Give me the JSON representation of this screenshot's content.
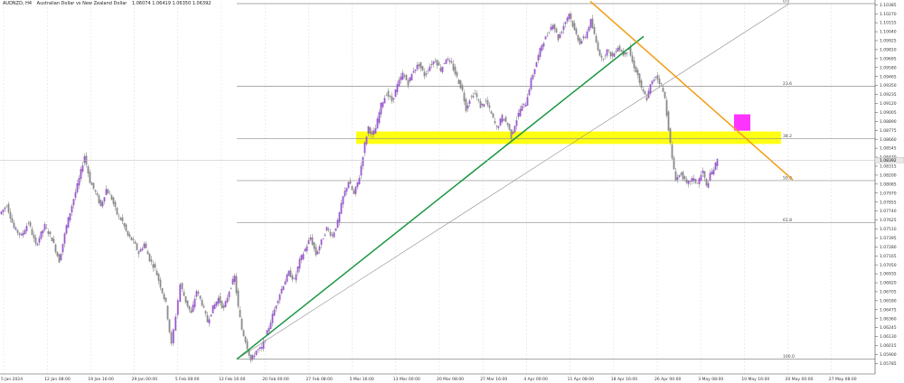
{
  "header": {
    "symbol": "AUDNZD, H4",
    "description": "Australian Dollar vs New Zealand Dollar",
    "ohlc": "1.06074 1.06419 1.06350 1.06392"
  },
  "colors": {
    "background": "#ffffff",
    "grid": "#d9d9d9",
    "bull": "#9b59d0",
    "bear": "#8a8a8a",
    "wick": "#777777",
    "fib": "#8c8c8c",
    "support_trend": "#1a9641",
    "resistance_trend": "#f39c12",
    "zone": "#ffff00",
    "marker": "#ff33ff",
    "thin_trend": "#888888"
  },
  "chart_data": {
    "type": "candlestick",
    "title": "",
    "xlabel": "",
    "ylabel": "",
    "ylim": [
      1.0565,
      1.104
    ],
    "y_ticks": [
      "1.10385",
      "1.10270",
      "1.10155",
      "1.10040",
      "1.09925",
      "1.09810",
      "1.09695",
      "1.09580",
      "1.09465",
      "1.09350",
      "1.09235",
      "1.09120",
      "1.09005",
      "1.08890",
      "1.08775",
      "1.08660",
      "1.08545",
      "1.08430",
      "1.08315",
      "1.08200",
      "1.08085",
      "1.07970",
      "1.07855",
      "1.07740",
      "1.07625",
      "1.07510",
      "1.07395",
      "1.07280",
      "1.07165",
      "1.07050",
      "1.06935",
      "1.06820",
      "1.06705",
      "1.06590",
      "1.06475",
      "1.06360",
      "1.06245",
      "1.06130",
      "1.06015",
      "1.05900",
      "1.05785"
    ],
    "current_price": "1.08392",
    "x_ticks": [
      "5 Jan 2024",
      "12 Jan 08:00",
      "19 Jan 16:00",
      "29 Jan 00:00",
      "5 Feb 08:00",
      "12 Feb 16:00",
      "20 Feb 00:00",
      "27 Feb 08:00",
      "5 Mar 16:00",
      "13 Mar 00:00",
      "20 Mar 08:00",
      "27 Mar 16:00",
      "4 Apr 00:00",
      "11 Apr 08:00",
      "18 Apr 16:00",
      "26 Apr 00:00",
      "3 May 08:00",
      "10 May 16:00",
      "20 May 00:00",
      "27 May 08:00"
    ],
    "close_path": [
      [
        0,
        1.077
      ],
      [
        8,
        1.0782
      ],
      [
        16,
        1.0752
      ],
      [
        24,
        1.0742
      ],
      [
        32,
        1.076
      ],
      [
        40,
        1.073
      ],
      [
        50,
        1.0755
      ],
      [
        58,
        1.0738
      ],
      [
        66,
        1.071
      ],
      [
        74,
        1.0755
      ],
      [
        82,
        1.079
      ],
      [
        88,
        1.0815
      ],
      [
        94,
        1.0845
      ],
      [
        100,
        1.0812
      ],
      [
        106,
        1.0798
      ],
      [
        112,
        1.078
      ],
      [
        118,
        1.0802
      ],
      [
        124,
        1.079
      ],
      [
        130,
        1.077
      ],
      [
        136,
        1.076
      ],
      [
        142,
        1.0742
      ],
      [
        148,
        1.0735
      ],
      [
        154,
        1.072
      ],
      [
        160,
        1.0732
      ],
      [
        166,
        1.0712
      ],
      [
        172,
        1.07
      ],
      [
        178,
        1.0678
      ],
      [
        184,
        1.0655
      ],
      [
        190,
        1.0602
      ],
      [
        195,
        1.064
      ],
      [
        200,
        1.068
      ],
      [
        206,
        1.0658
      ],
      [
        212,
        1.0642
      ],
      [
        218,
        1.0672
      ],
      [
        224,
        1.0655
      ],
      [
        230,
        1.0632
      ],
      [
        236,
        1.065
      ],
      [
        242,
        1.0662
      ],
      [
        248,
        1.0648
      ],
      [
        254,
        1.0672
      ],
      [
        260,
        1.069
      ],
      [
        264,
        1.065
      ],
      [
        268,
        1.0622
      ],
      [
        272,
        1.0608
      ],
      [
        278,
        1.0582
      ],
      [
        284,
        1.0595
      ],
      [
        290,
        1.0598
      ],
      [
        296,
        1.0618
      ],
      [
        302,
        1.064
      ],
      [
        308,
        1.0662
      ],
      [
        314,
        1.068
      ],
      [
        320,
        1.0695
      ],
      [
        326,
        1.0685
      ],
      [
        332,
        1.071
      ],
      [
        338,
        1.0725
      ],
      [
        344,
        1.074
      ],
      [
        350,
        1.0718
      ],
      [
        356,
        1.0735
      ],
      [
        362,
        1.0752
      ],
      [
        368,
        1.0742
      ],
      [
        374,
        1.076
      ],
      [
        380,
        1.0792
      ],
      [
        386,
        1.0812
      ],
      [
        392,
        1.0795
      ],
      [
        398,
        1.0818
      ],
      [
        404,
        1.086
      ],
      [
        408,
        1.0882
      ],
      [
        412,
        1.087
      ],
      [
        416,
        1.088
      ],
      [
        422,
        1.091
      ],
      [
        428,
        1.0925
      ],
      [
        434,
        1.0915
      ],
      [
        440,
        1.0935
      ],
      [
        446,
        1.095
      ],
      [
        452,
        1.0938
      ],
      [
        458,
        1.0955
      ],
      [
        464,
        1.0962
      ],
      [
        470,
        1.0948
      ],
      [
        476,
        1.096
      ],
      [
        482,
        1.0968
      ],
      [
        488,
        1.0955
      ],
      [
        494,
        1.097
      ],
      [
        500,
        1.0962
      ],
      [
        506,
        1.0945
      ],
      [
        512,
        1.0928
      ],
      [
        516,
        1.0905
      ],
      [
        520,
        1.0918
      ],
      [
        526,
        1.0925
      ],
      [
        532,
        1.0908
      ],
      [
        538,
        1.0915
      ],
      [
        544,
        1.0898
      ],
      [
        550,
        1.088
      ],
      [
        556,
        1.0895
      ],
      [
        562,
        1.0885
      ],
      [
        566,
        1.087
      ],
      [
        570,
        1.0885
      ],
      [
        576,
        1.0905
      ],
      [
        582,
        1.0912
      ],
      [
        588,
        1.0942
      ],
      [
        594,
        1.0965
      ],
      [
        600,
        1.0988
      ],
      [
        606,
        1.1
      ],
      [
        612,
        1.1015
      ],
      [
        618,
        1.0995
      ],
      [
        624,
        1.1012
      ],
      [
        630,
        1.1028
      ],
      [
        636,
        1.1005
      ],
      [
        642,
        1.099
      ],
      [
        648,
        1.0998
      ],
      [
        654,
        1.1018
      ],
      [
        660,
        1.099
      ],
      [
        666,
        1.0968
      ],
      [
        672,
        1.098
      ],
      [
        678,
        1.0972
      ],
      [
        684,
        1.0985
      ],
      [
        690,
        1.0975
      ],
      [
        696,
        1.0982
      ],
      [
        700,
        1.0965
      ],
      [
        706,
        1.0948
      ],
      [
        710,
        1.093
      ],
      [
        716,
        1.0918
      ],
      [
        720,
        1.0935
      ],
      [
        726,
        1.0948
      ],
      [
        732,
        1.0935
      ],
      [
        736,
        1.0918
      ],
      [
        740,
        1.088
      ],
      [
        744,
        1.084
      ],
      [
        748,
        1.0815
      ],
      [
        754,
        1.0822
      ],
      [
        760,
        1.0808
      ],
      [
        766,
        1.0815
      ],
      [
        772,
        1.081
      ],
      [
        778,
        1.0825
      ],
      [
        782,
        1.0805
      ],
      [
        786,
        1.082
      ],
      [
        790,
        1.0828
      ],
      [
        794,
        1.0839
      ]
    ],
    "fibonacci_levels": [
      {
        "label": "0.0",
        "value": 1.104
      },
      {
        "label": "23.6",
        "value": 1.0934
      },
      {
        "label": "38.2",
        "value": 1.0867
      },
      {
        "label": "50.0",
        "value": 1.0813
      },
      {
        "label": "61.8",
        "value": 1.0759
      },
      {
        "label": "100.0",
        "value": 1.0584
      }
    ],
    "yellow_zone": {
      "from": 1.086,
      "to": 1.0876
    },
    "support_trendline": [
      [
        1.0584
      ],
      [
        1.0998
      ]
    ],
    "resistance_trendline": [
      [
        1.1043
      ],
      [
        1.0814
      ]
    ],
    "thin_trendline": [
      [
        1.0584
      ],
      [
        1.104
      ]
    ]
  }
}
